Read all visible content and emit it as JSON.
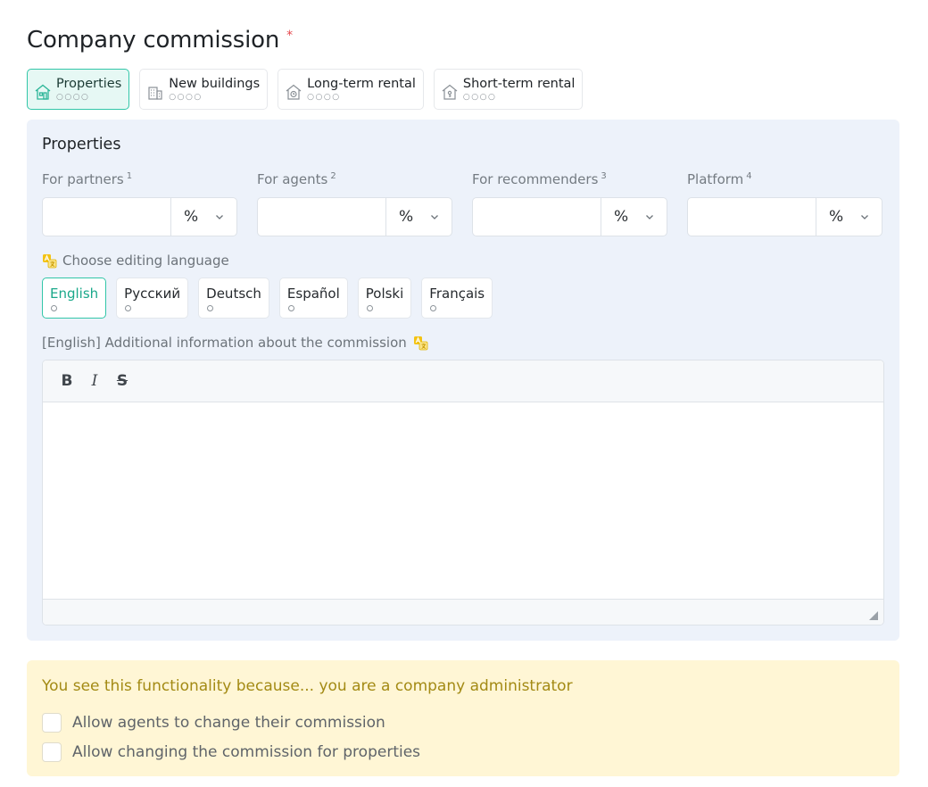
{
  "header": {
    "title": "Company commission",
    "required_mark": "*"
  },
  "category_tabs": [
    {
      "label": "Properties",
      "dots": "○○○○",
      "icon": "house-icon",
      "active": true
    },
    {
      "label": "New buildings",
      "dots": "○○○○",
      "icon": "building-icon",
      "active": false
    },
    {
      "label": "Long-term rental",
      "dots": "○○○○",
      "icon": "rental-house-icon",
      "active": false
    },
    {
      "label": "Short-term rental",
      "dots": "○○○○",
      "icon": "short-rental-icon",
      "active": false
    }
  ],
  "panel": {
    "title": "Properties",
    "fields": [
      {
        "label": "For partners",
        "sup": "1",
        "value": "",
        "unit": "%"
      },
      {
        "label": "For agents",
        "sup": "2",
        "value": "",
        "unit": "%"
      },
      {
        "label": "For recommenders",
        "sup": "3",
        "value": "",
        "unit": "%"
      },
      {
        "label": "Platform",
        "sup": "4",
        "value": "",
        "unit": "%"
      }
    ],
    "language_heading": "Choose editing language",
    "languages": [
      {
        "label": "English",
        "active": true
      },
      {
        "label": "Русский",
        "active": false
      },
      {
        "label": "Deutsch",
        "active": false
      },
      {
        "label": "Español",
        "active": false
      },
      {
        "label": "Polski",
        "active": false
      },
      {
        "label": "Français",
        "active": false
      }
    ],
    "info_heading": "[English] Additional information about the commission",
    "editor": {
      "bold": "B",
      "italic": "I",
      "strike": "S",
      "content": ""
    }
  },
  "admin": {
    "title": "You see this functionality because... you are a company administrator",
    "options": [
      {
        "label": "Allow agents to change their commission",
        "checked": false
      },
      {
        "label": "Allow changing the commission for properties",
        "checked": false
      }
    ]
  },
  "colors": {
    "accent": "#32c6a8",
    "panel_bg": "#edf2fa",
    "admin_bg": "#fff6d5",
    "admin_text": "#a38a14",
    "required": "#e5484d"
  }
}
